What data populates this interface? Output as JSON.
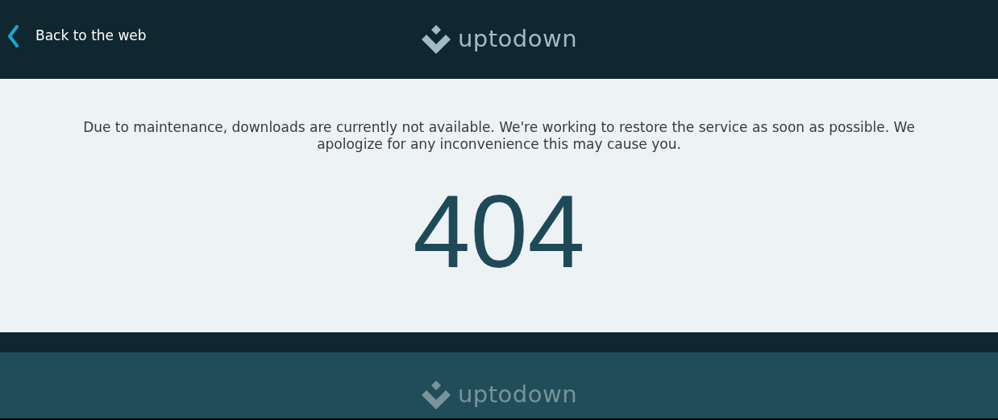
{
  "header": {
    "back_link": "Back to the web",
    "logo": "uptodown"
  },
  "message": "Due to maintenance, downloads are currently not available. We're working to restore the service as soon as possible. We apologize for any inconvenience this may cause you.",
  "error_code": "404",
  "footer": {
    "logo": "uptodown"
  }
}
